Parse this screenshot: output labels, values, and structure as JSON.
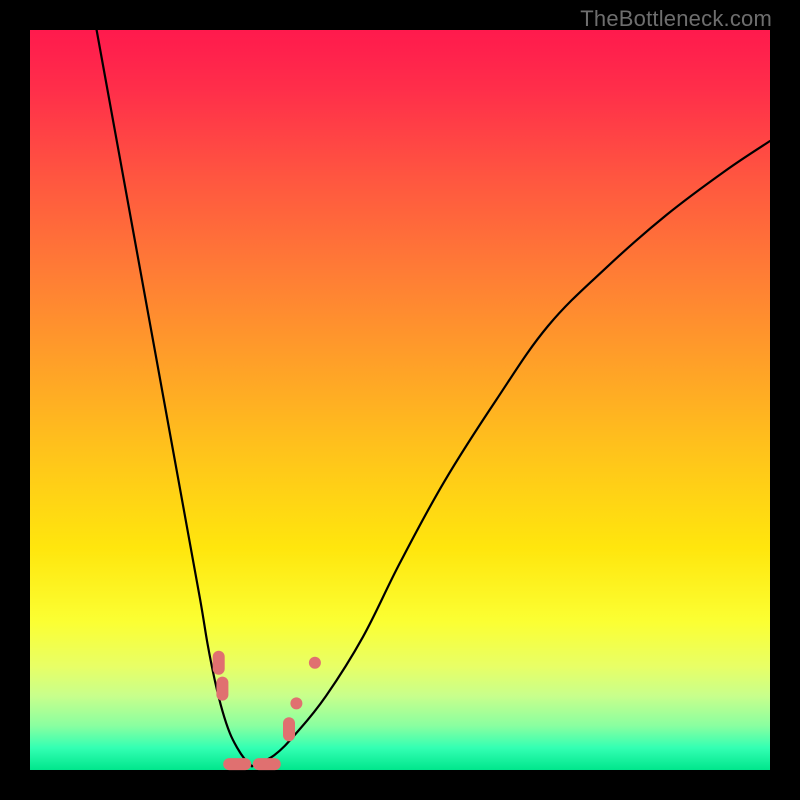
{
  "watermark": "TheBottleneck.com",
  "chart_data": {
    "type": "line",
    "title": "",
    "xlabel": "",
    "ylabel": "",
    "xlim": [
      0,
      100
    ],
    "ylim": [
      0,
      100
    ],
    "grid": false,
    "legend": false,
    "note": "Values estimated by pixel position; axes of original are unlabeled.",
    "series": [
      {
        "name": "left-branch",
        "x": [
          9,
          11,
          13,
          15,
          17,
          19,
          21,
          23,
          24,
          25,
          26,
          27,
          28,
          29,
          30
        ],
        "y": [
          100,
          89,
          78,
          67,
          56,
          45,
          34,
          23,
          17,
          12,
          8,
          5,
          3,
          1.5,
          0.5
        ]
      },
      {
        "name": "right-branch",
        "x": [
          30,
          33,
          36,
          40,
          45,
          50,
          56,
          63,
          70,
          78,
          86,
          94,
          100
        ],
        "y": [
          0.5,
          2,
          5,
          10,
          18,
          28,
          39,
          50,
          60,
          68,
          75,
          81,
          85
        ]
      }
    ],
    "markers": [
      {
        "name": "left-pair-top",
        "x": 25.5,
        "y": 14.5,
        "shape": "capsule-v"
      },
      {
        "name": "left-pair-bottom",
        "x": 26.0,
        "y": 11.0,
        "shape": "capsule-v"
      },
      {
        "name": "floor-left",
        "x": 28.0,
        "y": 0.8,
        "shape": "capsule-h"
      },
      {
        "name": "floor-right",
        "x": 32.0,
        "y": 0.8,
        "shape": "capsule-h"
      },
      {
        "name": "right-lower",
        "x": 35.0,
        "y": 5.5,
        "shape": "capsule-v"
      },
      {
        "name": "right-upper",
        "x": 36.0,
        "y": 9.0,
        "shape": "dot"
      },
      {
        "name": "right-top",
        "x": 38.5,
        "y": 14.5,
        "shape": "dot"
      }
    ],
    "colors": {
      "gradient_top": "#ff1a4d",
      "gradient_mid": "#ffe60d",
      "gradient_bottom": "#00e68c",
      "curve": "#000000",
      "marker": "#e07070",
      "frame": "#000000"
    }
  }
}
